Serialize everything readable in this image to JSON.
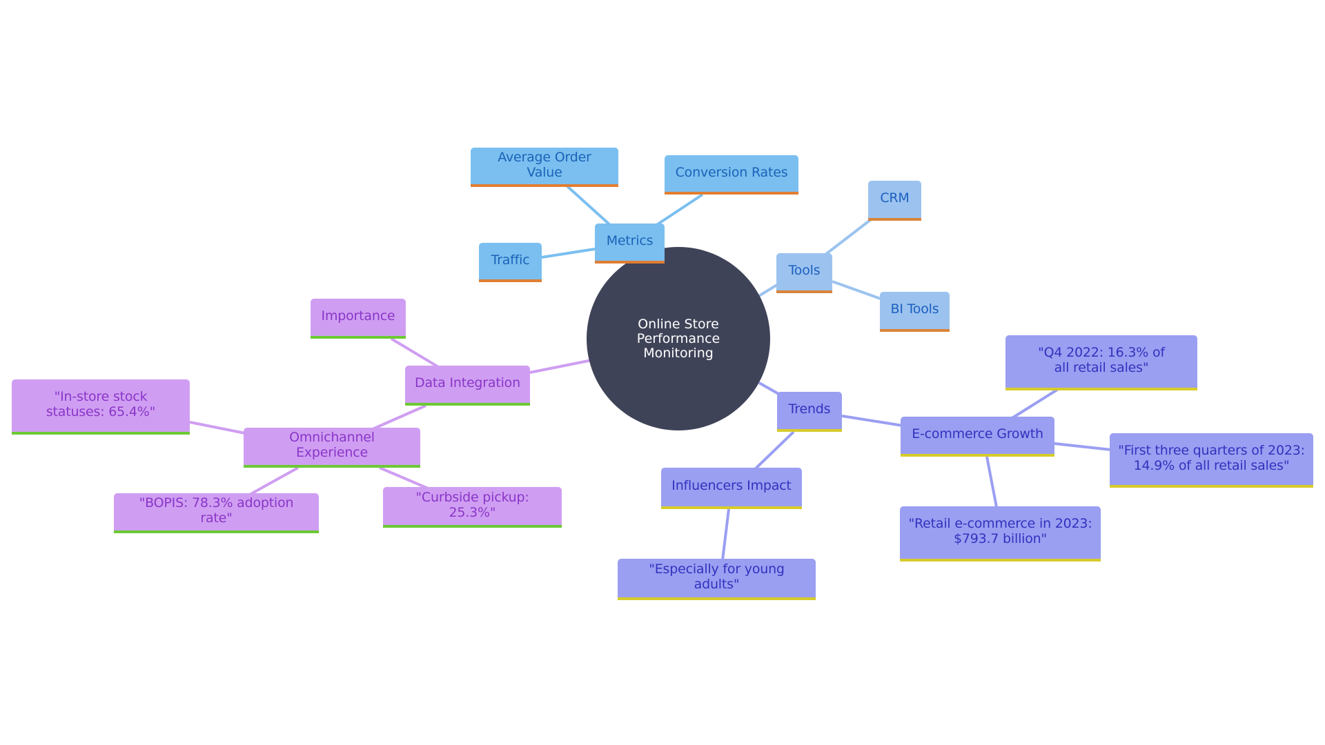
{
  "diagram": {
    "type": "mindmap",
    "root": {
      "label": "Online Store Performance Monitoring",
      "color": "#3f4358"
    },
    "branches": [
      {
        "id": "metrics",
        "label": "Metrics",
        "colors": {
          "fill": "#7bbff0",
          "text": "#1a63b8",
          "accent": "#e07e32",
          "edge": "#7bbff0"
        },
        "children": [
          {
            "label": "Average Order Value"
          },
          {
            "label": "Conversion Rates"
          },
          {
            "label": "Traffic"
          }
        ]
      },
      {
        "id": "tools",
        "label": "Tools",
        "colors": {
          "fill": "#9cc3ef",
          "text": "#1c5fc0",
          "accent": "#d9843a",
          "edge": "#9cc3ef"
        },
        "children": [
          {
            "label": "CRM"
          },
          {
            "label": "BI Tools"
          }
        ]
      },
      {
        "id": "trends",
        "label": "Trends",
        "colors": {
          "fill": "#9a9ff2",
          "text": "#3232bd",
          "accent": "#d6cc2a",
          "edge": "#9a9ff2"
        },
        "children": [
          {
            "label": "E-commerce Growth",
            "children": [
              {
                "label": "\"Q4 2022: 16.3% of all retail sales\""
              },
              {
                "label": "\"First three quarters of 2023: 14.9% of all retail sales\""
              },
              {
                "label": "\"Retail e-commerce in 2023: $793.7 billion\""
              }
            ]
          },
          {
            "label": "Influencers Impact",
            "children": [
              {
                "label": "\"Especially for young adults\""
              }
            ]
          }
        ]
      },
      {
        "id": "data-integration",
        "label": "Data Integration",
        "colors": {
          "fill": "#cf9ef2",
          "text": "#8a35c8",
          "accent": "#6cc934",
          "edge": "#cf9ef2"
        },
        "children": [
          {
            "label": "Importance"
          },
          {
            "label": "Omnichannel Experience",
            "children": [
              {
                "label": "\"In-store stock statuses: 65.4%\""
              },
              {
                "label": "\"BOPIS: 78.3% adoption rate\""
              },
              {
                "label": "\"Curbside pickup: 25.3%\""
              }
            ]
          }
        ]
      }
    ]
  }
}
